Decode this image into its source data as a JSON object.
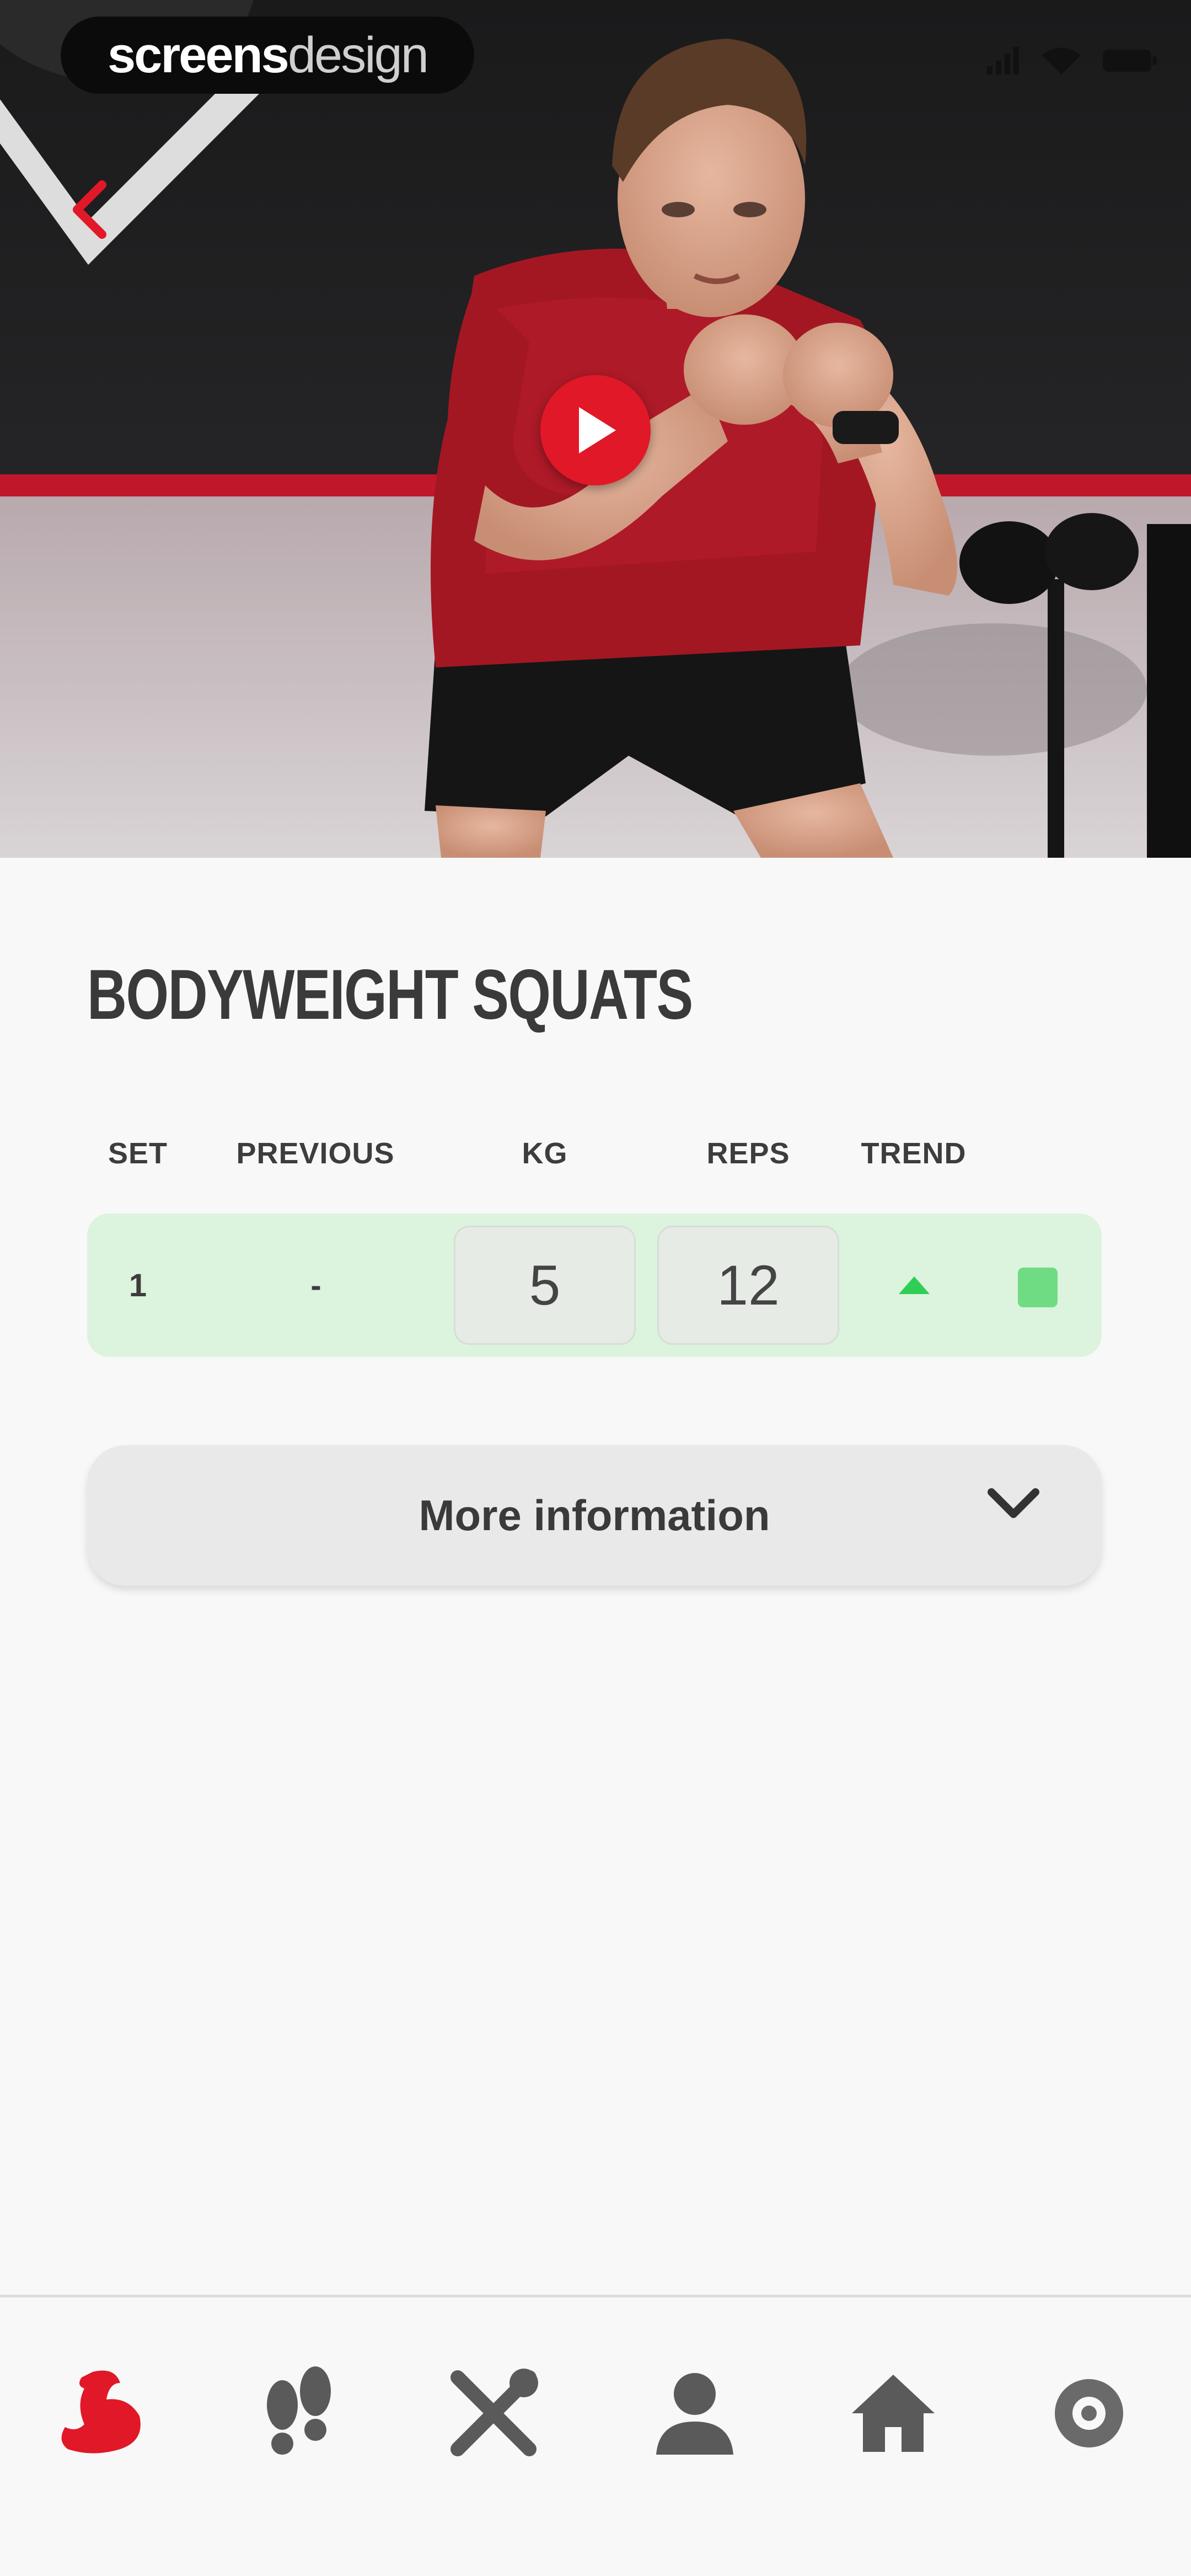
{
  "hero": {
    "brand_bold": "screens",
    "brand_light": "design"
  },
  "exercise": {
    "title": "BODYWEIGHT SQUATS"
  },
  "table": {
    "headers": {
      "set": "SET",
      "previous": "PREVIOUS",
      "kg": "KG",
      "reps": "REPS",
      "trend": "TREND"
    },
    "rows": [
      {
        "set": "1",
        "previous": "-",
        "kg": "5",
        "reps": "12",
        "trend": "up"
      }
    ]
  },
  "more": {
    "label": "More information"
  },
  "nav": {
    "items": [
      "workout-icon",
      "steps-icon",
      "nutrition-icon",
      "profile-icon",
      "home-icon",
      "settings-icon"
    ],
    "active": "workout-icon"
  },
  "colors": {
    "accent": "#e11827",
    "row_bg": "#dcf3dd",
    "trend": "#2fce55",
    "check": "#6fdc84"
  }
}
